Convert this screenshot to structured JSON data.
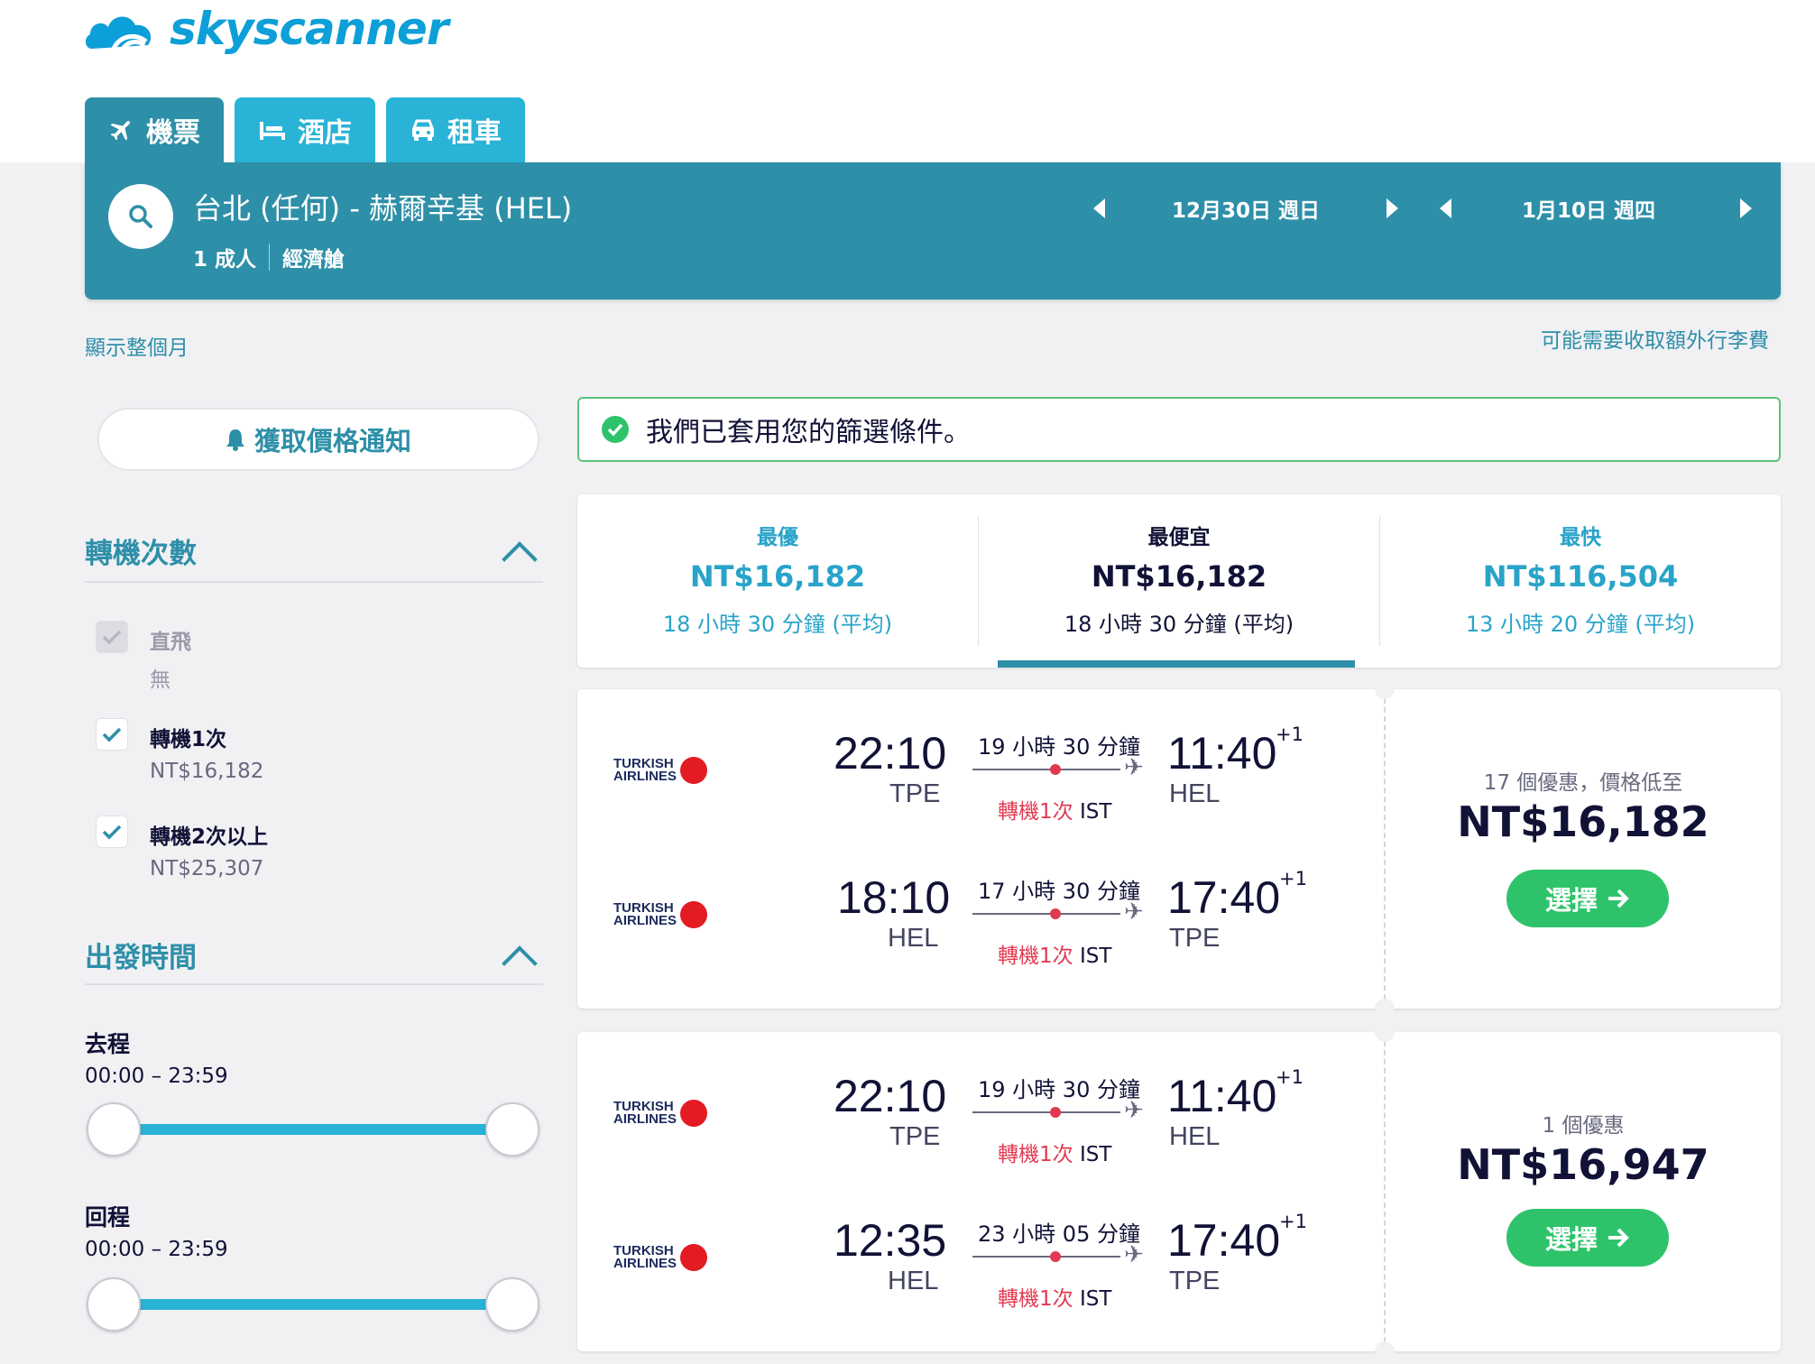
{
  "brand": {
    "name": "skyscanner",
    "color": "#0d9fd8"
  },
  "tabs": [
    {
      "label": "機票",
      "icon": "plane-icon"
    },
    {
      "label": "酒店",
      "icon": "bed-icon"
    },
    {
      "label": "租車",
      "icon": "car-icon"
    }
  ],
  "search": {
    "route": "台北 (任何) - 赫爾辛基 (HEL)",
    "passengers": "1 成人",
    "cabin": "經濟艙",
    "depart_date": "12月30日 週日",
    "return_date": "1月10日 週四"
  },
  "links": {
    "whole_month": "顯示整個月",
    "baggage": "可能需要收取額外行李費"
  },
  "price_alert": {
    "label": "獲取價格通知"
  },
  "filters": {
    "stops": {
      "title": "轉機次數",
      "options": [
        {
          "label": "直飛",
          "sub": "無",
          "checked": true,
          "disabled": true
        },
        {
          "label": "轉機1次",
          "sub": "NT$16,182",
          "checked": true
        },
        {
          "label": "轉機2次以上",
          "sub": "NT$25,307",
          "checked": true
        }
      ]
    },
    "times": {
      "title": "出發時間",
      "outbound": {
        "label": "去程",
        "range": "00:00 – 23:59"
      },
      "inbound": {
        "label": "回程",
        "range": "00:00 – 23:59"
      }
    }
  },
  "applied_notice": "我們已套用您的篩選條件。",
  "sort": [
    {
      "label": "最優",
      "price": "NT$16,182",
      "duration": "18 小時 30 分鐘 (平均)"
    },
    {
      "label": "最便宜",
      "price": "NT$16,182",
      "duration": "18 小時 30 分鐘 (平均)",
      "selected": true
    },
    {
      "label": "最快",
      "price": "NT$116,504",
      "duration": "13 小時 20 分鐘 (平均)"
    }
  ],
  "results": [
    {
      "legs": [
        {
          "airline": "TURKISH AIRLINES",
          "dep_time": "22:10",
          "dep_iata": "TPE",
          "duration": "19 小時 30 分鐘",
          "stops": "轉機1次",
          "via": "IST",
          "arr_time": "11:40",
          "arr_iata": "HEL",
          "day_offset": "+1"
        },
        {
          "airline": "TURKISH AIRLINES",
          "dep_time": "18:10",
          "dep_iata": "HEL",
          "duration": "17 小時 30 分鐘",
          "stops": "轉機1次",
          "via": "IST",
          "arr_time": "17:40",
          "arr_iata": "TPE",
          "day_offset": "+1"
        }
      ],
      "deals": "17 個優惠，價格低至",
      "price": "NT$16,182",
      "button": "選擇"
    },
    {
      "legs": [
        {
          "airline": "TURKISH AIRLINES",
          "dep_time": "22:10",
          "dep_iata": "TPE",
          "duration": "19 小時 30 分鐘",
          "stops": "轉機1次",
          "via": "IST",
          "arr_time": "11:40",
          "arr_iata": "HEL",
          "day_offset": "+1"
        },
        {
          "airline": "TURKISH AIRLINES",
          "dep_time": "12:35",
          "dep_iata": "HEL",
          "duration": "23 小時 05 分鐘",
          "stops": "轉機1次",
          "via": "IST",
          "arr_time": "17:40",
          "arr_iata": "TPE",
          "day_offset": "+1"
        }
      ],
      "deals": "1 個優惠",
      "price": "NT$16,947",
      "button": "選擇"
    }
  ]
}
